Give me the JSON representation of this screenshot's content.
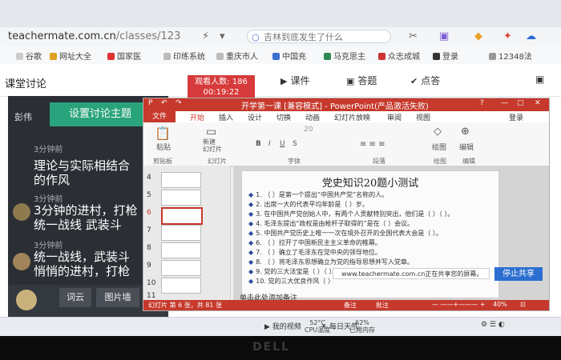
{
  "browser": {
    "url_domain": "teachermate.com.cn",
    "url_path": "/classes/123",
    "search_placeholder": "吉林到底发生了什么"
  },
  "bookmarks": [
    "谷歌",
    "网址大全",
    "国家医",
    "印练系统",
    "重庆市人",
    "中国充",
    "马克思主",
    "众志成城",
    "登录",
    "12348法"
  ],
  "classroom": {
    "title": "课堂讨论",
    "viewers_label": "观看人数: 186",
    "timer": "00:19:22",
    "nav": {
      "courseware": "课件",
      "answer": "答题",
      "rollcall": "点答",
      "discuss": "讨论"
    }
  },
  "discussion": {
    "user": "彭伟",
    "set_topic_button": "设置讨论主题",
    "messages": [
      {
        "time": "3分钟前",
        "line1": "理论与实际相结合",
        "line2": "的作风"
      },
      {
        "time": "3分钟前",
        "line1": "3分钟的进村，打枪",
        "line2": "统一战线 武装斗"
      },
      {
        "time": "3分钟前",
        "line1": "统一战线，武装斗",
        "line2": "悄悄的进村，打枪"
      }
    ],
    "bottom_buttons": [
      "词云",
      "图片墙"
    ]
  },
  "ppt": {
    "window_title": "开学第一课 [兼容模式] - PowerPoint(产品激活失败)",
    "tabs": [
      "文件",
      "开始",
      "插入",
      "设计",
      "切换",
      "动画",
      "幻灯片放映",
      "审阅",
      "视图"
    ],
    "signin": "登录",
    "ribbon_groups": [
      "剪贴板",
      "幻灯片",
      "字体",
      "段落",
      "绘图",
      "编辑"
    ],
    "ribbon_buttons": {
      "paste": "粘贴",
      "new_slide": "新建\n幻灯片",
      "drawing": "绘图",
      "editing": "编辑"
    },
    "font_size": "20",
    "thumb_numbers": [
      "4",
      "5",
      "6",
      "7",
      "8",
      "9",
      "10",
      "11"
    ],
    "selected_thumb": "6",
    "slide_title": "党史知识20题小测试",
    "questions": [
      "1. （ ）是第一个提出“中国共产党”名称的人。",
      "2. 出席一大的代表平均年龄是（ ）岁。",
      "3. 在中国共产党创始人中，有两个人贡献特别突出，他们是（ ）（ ）。",
      "4. 毛泽东提出“政权是由枪杆子取得的”是在（ ）会议。",
      "5. 中国共产党历史上唯一一次在境外召开的全国代表大会是（ ）。",
      "6. （ ）拉开了中国新民主主义革命的帷幕。",
      "7. （ ）确立了毛泽东在党中央的领导地位。",
      "8. （ ）将毛泽东思想确立为党的指导思想并写入党章。",
      "9. 党的三大法宝是（ ）（ ）。",
      "10. 党的三大优良作风（ ）"
    ],
    "notes_hint": "单击此处添加备注",
    "share_note": "www.teachermate.com.cn正在共享您的屏幕。",
    "stop_share": "停止共享",
    "status": {
      "slide_info": "幻灯片 第 6 张，共 81 张",
      "notes": "备注",
      "comments": "批注",
      "zoom": "40%"
    }
  },
  "taskbar": {
    "items": [
      "我的视频",
      "每日天气"
    ],
    "cpu_temp": "52°C",
    "cpu_label": "CPU温度",
    "mem": "62%",
    "mem_label": "已用内存"
  },
  "monitor_logo": "DELL",
  "colors": {
    "discuss_green": "#29a37c",
    "ppt_red": "#c6392c",
    "viewer_red": "#d73a3a",
    "share_blue": "#2c6fd0"
  }
}
